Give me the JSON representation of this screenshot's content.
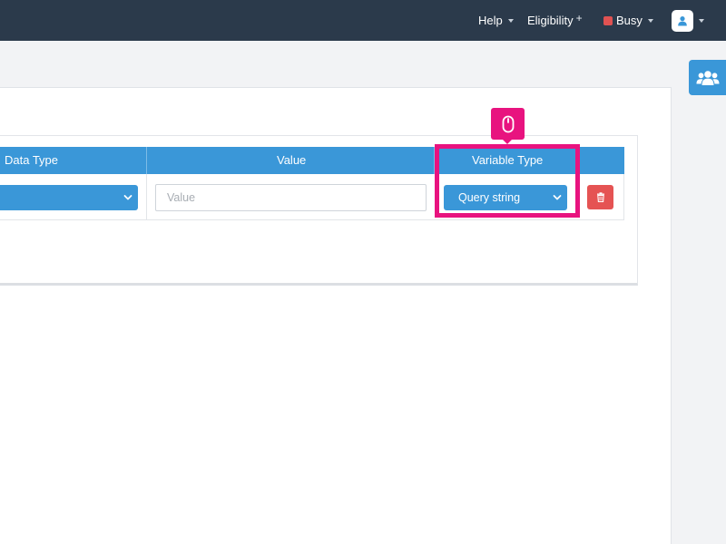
{
  "topbar": {
    "help_label": "Help",
    "eligibility_label": "Eligibility",
    "eligibility_plus": "+",
    "status_label": "Busy",
    "status_color": "#e05252"
  },
  "grid": {
    "headers": [
      "Data Type",
      "Value",
      "Variable Type"
    ],
    "row": {
      "data_type_value": "",
      "value_placeholder": "Value",
      "value_current": "",
      "variable_type_value": "Query string"
    }
  },
  "icons": {
    "users": "users-group-icon",
    "avatar": "user-icon",
    "delete": "trash-icon",
    "callout": "mouse-click-icon"
  },
  "colors": {
    "topbar_bg": "#2b3a4b",
    "accent_blue": "#3a97d8",
    "danger_red": "#e55353",
    "highlight_pink": "#e8137f"
  }
}
